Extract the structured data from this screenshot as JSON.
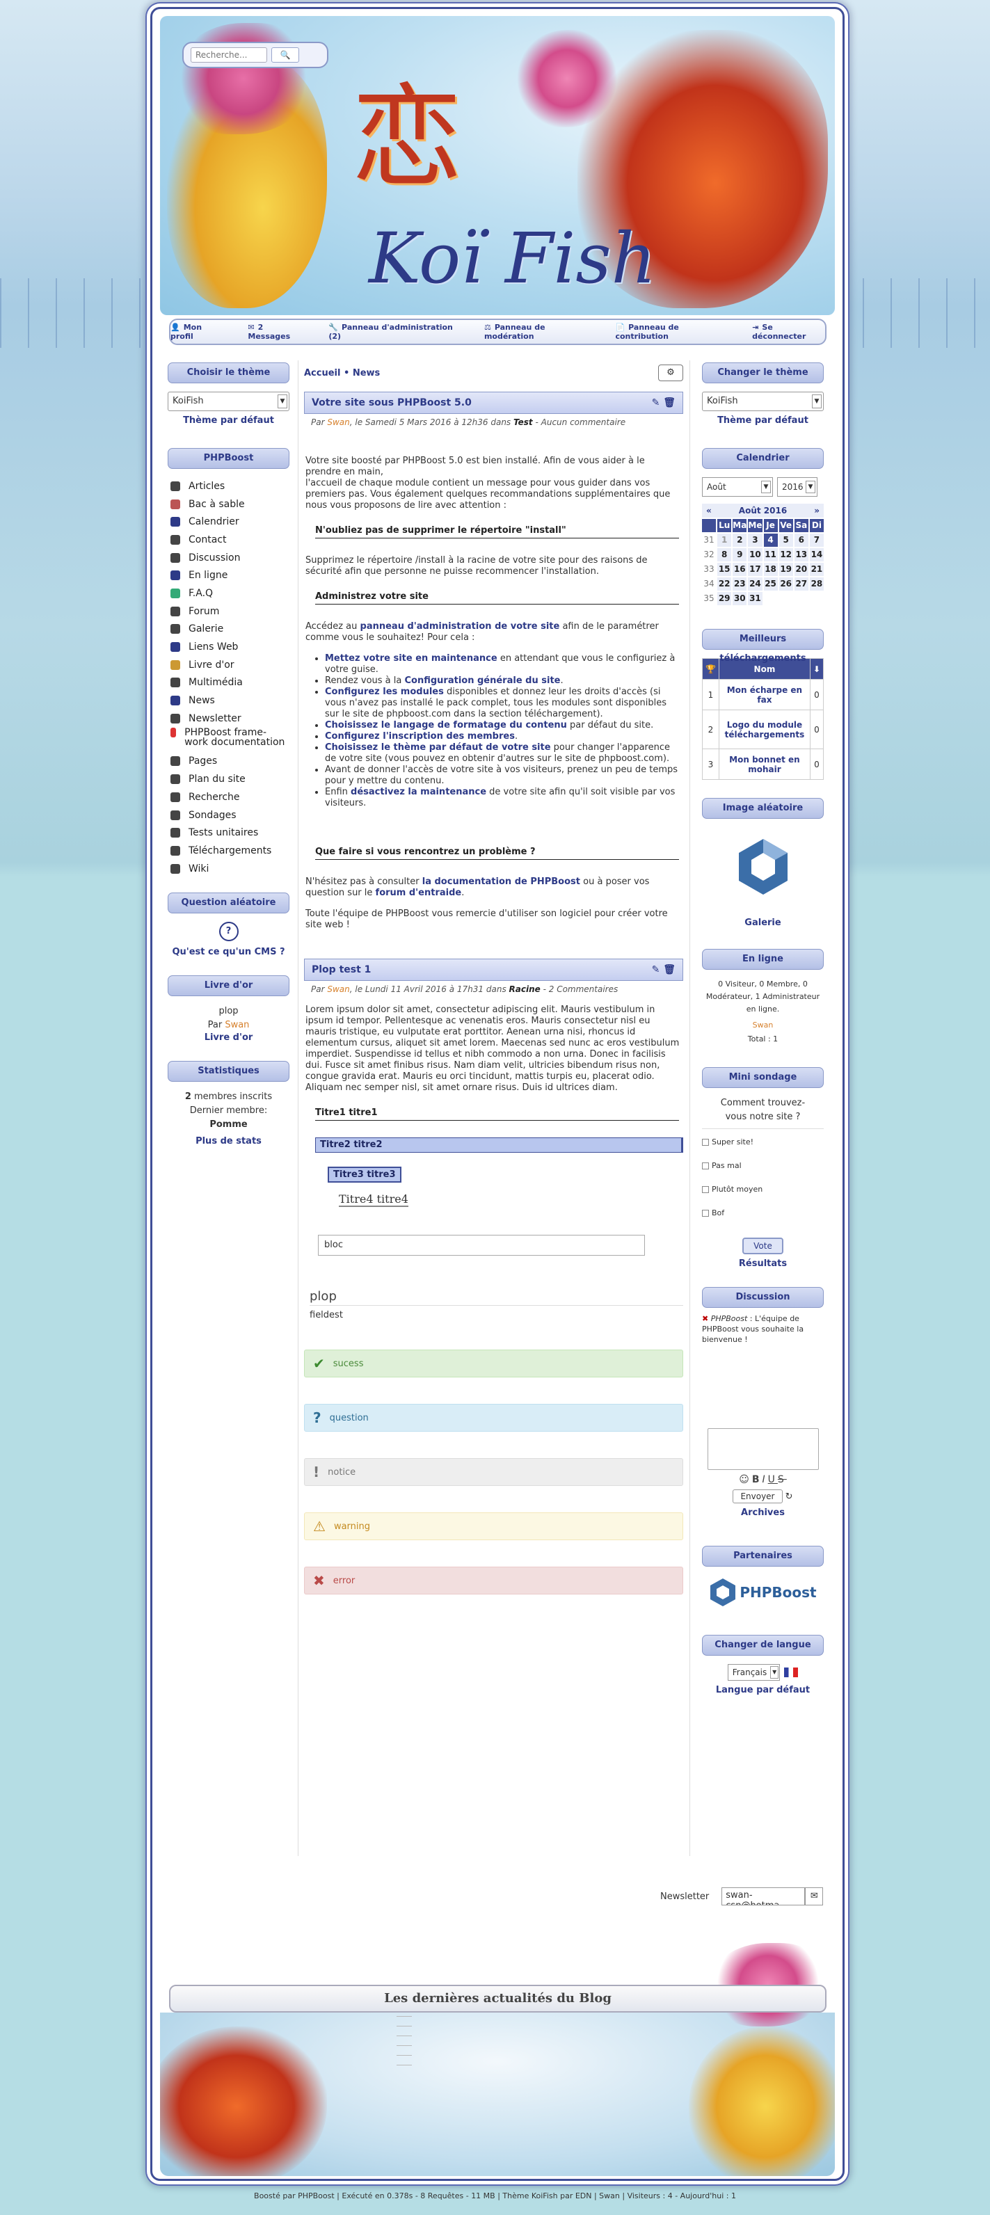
{
  "search": {
    "placeholder": "Recherche..."
  },
  "header": {
    "kanji": "恋",
    "title": "Koï Fish"
  },
  "userbar": [
    {
      "label": "Mon profil"
    },
    {
      "label": "2 Messages"
    },
    {
      "label": "Panneau d'administration (2)"
    },
    {
      "label": "Panneau de modération"
    },
    {
      "label": "Panneau de contribution"
    },
    {
      "label": "Se déconnecter"
    }
  ],
  "left": {
    "theme_title": "Choisir le thème",
    "theme_value": "KoiFish",
    "theme_default": "Thème par défaut",
    "menu_title": "PHPBoost",
    "menu": [
      "Articles",
      "Bac à sable",
      "Calendrier",
      "Contact",
      "Discussion",
      "En ligne",
      "F.A.Q",
      "Forum",
      "Galerie",
      "Liens Web",
      "Livre d'or",
      "Multimédia",
      "News",
      "Newsletter",
      "PHPBoost frame-work documentation",
      "Pages",
      "Plan du site",
      "Recherche",
      "Sondages",
      "Tests unitaires",
      "Téléchargements",
      "Wiki"
    ],
    "question_title": "Question aléatoire",
    "question": "Qu'est ce qu'un CMS ?",
    "guestbook_title": "Livre d'or",
    "guestbook_msg": "plop",
    "guestbook_by": "Par",
    "guestbook_author": "Swan",
    "guestbook_link": "Livre d'or",
    "stats_title": "Statistiques",
    "stats_members": "2",
    "stats_members_label": "membres inscrits",
    "stats_last": "Dernier membre:",
    "stats_last_name": "Pomme",
    "stats_more": "Plus de stats"
  },
  "main": {
    "crumb_home": "Accueil",
    "crumb_sep": "•",
    "crumb_news": "News",
    "a1": {
      "title": "Votre site sous PHPBoost 5.0",
      "meta_par": "Par",
      "meta_author": "Swan",
      "meta_date": ", le Samedi 5 Mars 2016 à 12h36 dans",
      "meta_cat": "Test",
      "meta_comments": "- Aucun commentaire",
      "p1": "Votre site boosté par PHPBoost 5.0 est bien installé. Afin de vous aider à le prendre en main,",
      "p2": "l'accueil de chaque module contient un message pour vous guider dans vos premiers pas. Vous également quelques recommandations supplémentaires que nous vous proposons de lire avec attention :",
      "h1": "N'oubliez pas de supprimer le répertoire \"install\"",
      "p3": "Supprimez le répertoire /install à la racine de votre site pour des raisons de sécurité afin que personne ne puisse recommencer l'installation.",
      "h2": "Administrez votre site",
      "p4a": "Accédez au",
      "p4b": "panneau d'administration de votre site",
      "p4c": "afin de le paramétrer comme vous le souhaitez! Pour cela :",
      "li": [
        {
          "b": "Mettez votre site en maintenance",
          "t": " en attendant que vous le configuriez à votre guise."
        },
        {
          "t": "Rendez vous à la ",
          "b": "Configuration générale du site",
          "t2": "."
        },
        {
          "b": "Configurez les modules",
          "t": " disponibles et donnez leur les droits d'accès (si vous n'avez pas installé le pack complet, tous les modules sont disponibles sur le site de phpboost.com dans la section téléchargement)."
        },
        {
          "b": "Choisissez le langage de formatage du contenu",
          "t": " par défaut du site."
        },
        {
          "b": "Configurez l'inscription des membres",
          "t": "."
        },
        {
          "b": "Choisissez le thème par défaut de votre site",
          "t": " pour changer l'apparence de votre site (vous pouvez en obtenir d'autres sur le site de phpboost.com)."
        },
        {
          "t": "Avant de donner l'accès de votre site à vos visiteurs, prenez un peu de temps pour y mettre du contenu."
        },
        {
          "t": "Enfin ",
          "b": "désactivez la maintenance",
          "t2": " de votre site afin qu'il soit visible par vos visiteurs."
        }
      ],
      "h3": "Que faire si vous rencontrez un problème ?",
      "p5a": "N'hésitez pas à consulter",
      "p5b": "la documentation de PHPBoost",
      "p5c": "ou à poser vos question sur le",
      "p5d": "forum d'entraide",
      "p6": "Toute l'équipe de PHPBoost vous remercie d'utiliser son logiciel pour créer votre site web !"
    },
    "a2": {
      "title": "Plop test 1",
      "meta_par": "Par",
      "meta_author": "Swan",
      "meta_date": ", le Lundi 11 Avril 2016 à 17h31 dans",
      "meta_cat": "Racine",
      "meta_comments": "- 2 Commentaires",
      "lorem": "Lorem ipsum dolor sit amet, consectetur adipiscing elit. Mauris vestibulum in ipsum id tempor. Pellentesque ac venenatis eros. Mauris consectetur nisl eu mauris tristique, eu vulputate erat porttitor. Aenean urna nisi, rhoncus id elementum cursus, aliquet sit amet lorem. Maecenas sed nunc ac eros vestibulum imperdiet. Suspendisse id tellus et nibh commodo a non urna. Donec in facilisis dui. Fusce sit amet finibus risus. Nam diam velit, ultricies bibendum risus non, congue gravida erat. Mauris eu orci tincidunt, mattis turpis eu, placerat odio. Aliquam nec semper nisl, sit amet ornare risus. Duis id ultrices diam.",
      "t1": "Titre1 titre1",
      "t2": "Titre2 titre2",
      "t3": "Titre3 titre3",
      "t4": "Titre4 titre4",
      "bloc": "bloc",
      "legend": "plop",
      "fieldset": "fieldest",
      "success": "sucess",
      "question": "question",
      "notice": "notice",
      "warning": "warning",
      "error": "error"
    }
  },
  "right": {
    "theme_title": "Changer le thème",
    "theme_value": "KoiFish",
    "theme_default": "Thème par défaut",
    "cal_title": "Calendrier",
    "cal_month_sel": "Août",
    "cal_year_sel": "2016",
    "cal_month": "Août 2016",
    "cal_prev": "«",
    "cal_next": "»",
    "cal_days": [
      "Lu",
      "Ma",
      "Me",
      "Je",
      "Ve",
      "Sa",
      "Di"
    ],
    "cal_rows": [
      [
        "31",
        "1",
        "2",
        "3",
        "4",
        "5",
        "6",
        "7"
      ],
      [
        "32",
        "8",
        "9",
        "10",
        "11",
        "12",
        "13",
        "14"
      ],
      [
        "33",
        "15",
        "16",
        "17",
        "18",
        "19",
        "20",
        "21"
      ],
      [
        "34",
        "22",
        "23",
        "24",
        "25",
        "26",
        "27",
        "28"
      ],
      [
        "35",
        "29",
        "30",
        "31",
        "",
        "",
        "",
        ""
      ]
    ],
    "dl_title": "Meilleurs téléchargements",
    "dl_col": "Nom",
    "dl": [
      {
        "rank": "1",
        "name": "Mon écharpe en fax",
        "count": "0"
      },
      {
        "rank": "2",
        "name": "Logo du module téléchargements",
        "count": "0"
      },
      {
        "rank": "3",
        "name": "Mon bonnet en mohair",
        "count": "0"
      }
    ],
    "img_title": "Image aléatoire",
    "img_link": "Galerie",
    "online_title": "En ligne",
    "online_text": "0 Visiteur, 0 Membre, 0 Modérateur, 1 Administrateur en ligne.",
    "online_user": "Swan",
    "online_total": "Total : 1",
    "poll_title": "Mini sondage",
    "poll_q": "Comment trouvez-vous notre site ?",
    "poll_opts": [
      "Super site!",
      "Pas mal",
      "Plutôt moyen",
      "Bof"
    ],
    "poll_vote": "Vote",
    "poll_results": "Résultats",
    "chat_title": "Discussion",
    "chat_author": "PHPBoost",
    "chat_msg": " : L'équipe de PHPBoost vous souhaite la bienvenue !",
    "chat_send": "Envoyer",
    "chat_archives": "Archives",
    "partners_title": "Partenaires",
    "partner": "PHPBoost",
    "lang_title": "Changer de langue",
    "lang_value": "Français",
    "lang_default": "Langue par défaut"
  },
  "newsletter": {
    "label": "Newsletter",
    "value": "swan-csn@hotma"
  },
  "footer": {
    "news_title": "Les dernières actualités du Blog",
    "bottom": "Boosté par PHPBoost | Exécuté en 0.378s - 8 Requêtes - 11 MB | Thème KoiFish par EDN | Swan | Visiteurs : 4 - Aujourd'hui : 1"
  }
}
